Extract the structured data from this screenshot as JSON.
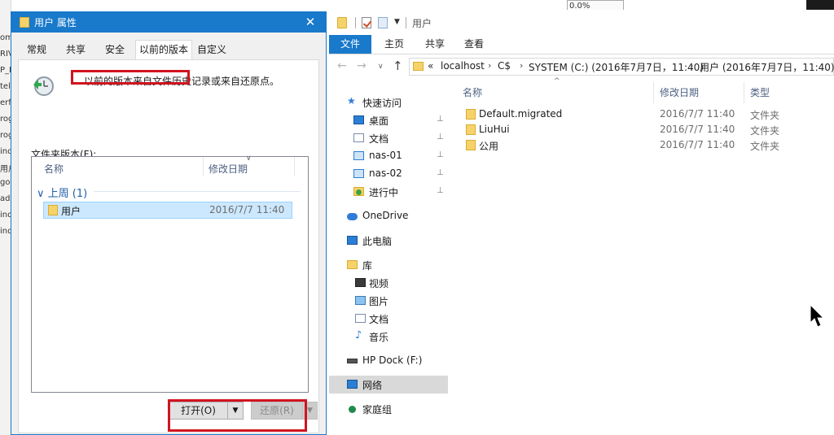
{
  "background_strip": {
    "fragments": [
      "om",
      "RIV",
      "P_L",
      "tel",
      "erf",
      "rog",
      "rog",
      "ind",
      "用户",
      "go",
      "ad",
      "ind",
      "ind"
    ]
  },
  "explorer": {
    "title": "用户",
    "progress_text": "0.0%",
    "ribbon_tabs": [
      "文件",
      "主页",
      "共享",
      "查看"
    ],
    "address": {
      "chevrons": "«",
      "segments": [
        "localhost",
        "C$",
        "SYSTEM (C:) (2016年7月7日，11:40)",
        "用户 (2016年7月7日，11:40)"
      ],
      "separator": "›"
    },
    "nav_pane": {
      "quick_access": "快速访问",
      "items": [
        {
          "label": "桌面",
          "icon": "desktop-icon",
          "pinned": true
        },
        {
          "label": "文档",
          "icon": "document-icon",
          "pinned": true
        },
        {
          "label": "nas-01",
          "icon": "network-computer-icon",
          "pinned": true
        },
        {
          "label": "nas-02",
          "icon": "network-computer-icon",
          "pinned": true
        },
        {
          "label": "进行中",
          "icon": "folder-icon",
          "pinned": true
        }
      ],
      "onedrive": "OneDrive",
      "this_pc": "此电脑",
      "libraries": "库",
      "library_items": [
        "视频",
        "图片",
        "文档",
        "音乐"
      ],
      "hp_dock": "HP Dock (F:)",
      "network": "网络",
      "homegroup": "家庭组",
      "pin_glyph": "📌"
    },
    "columns": {
      "name": "名称",
      "date": "修改日期",
      "type": "类型"
    },
    "files": [
      {
        "name": "Default.migrated",
        "date": "2016/7/7 11:40",
        "type": "文件夹"
      },
      {
        "name": "LiuHui",
        "date": "2016/7/7 11:40",
        "type": "文件夹"
      },
      {
        "name": "公用",
        "date": "2016/7/7 11:40",
        "type": "文件夹"
      }
    ]
  },
  "dialog": {
    "title": "用户 属性",
    "close_glyph": "✕",
    "tabs": [
      "常规",
      "共享",
      "安全",
      "以前的版本",
      "自定义"
    ],
    "active_tab_index": 3,
    "description": "以前的版本来自文件历史记录或来自还原点。",
    "versions_label": "文件夹版本(F):",
    "list": {
      "col_name": "名称",
      "col_date": "修改日期",
      "group": "上周 (1)",
      "group_chevron": "∨",
      "rows": [
        {
          "name": "用户",
          "date": "2016/7/7 11:40"
        }
      ]
    },
    "buttons": {
      "open": "打开(O)",
      "restore": "还原(R)",
      "dropdown_glyph": "▼"
    }
  },
  "colors": {
    "accent": "#1979ca",
    "highlight_red": "#d0141f",
    "selection": "#cce8ff",
    "folder": "#f6d36a"
  }
}
